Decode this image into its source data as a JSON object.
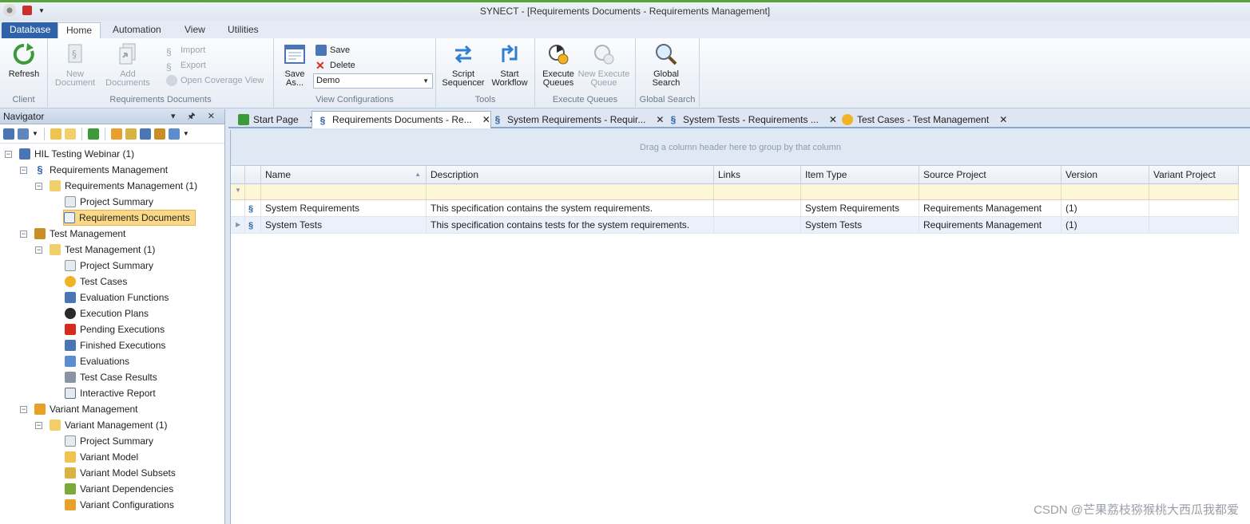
{
  "window": {
    "title": "SYNECT - [Requirements Documents - Requirements Management]"
  },
  "menu_tabs": [
    "Database",
    "Home",
    "Automation",
    "View",
    "Utilities"
  ],
  "ribbon": {
    "client": {
      "refresh": "Refresh",
      "label": "Client"
    },
    "req_docs": {
      "new_document": "New\nDocument",
      "add_documents": "Add\nDocuments",
      "import": "Import",
      "export": "Export",
      "open_coverage": "Open Coverage View",
      "label": "Requirements Documents"
    },
    "view_configs": {
      "save_as": "Save\nAs...",
      "save": "Save",
      "delete": "Delete",
      "selected": "Demo",
      "label": "View Configurations"
    },
    "tools": {
      "script_sequencer": "Script\nSequencer",
      "start_workflow": "Start\nWorkflow",
      "label": "Tools"
    },
    "execute_queues": {
      "execute": "Execute\nQueues",
      "new_execute": "New Execute\nQueue",
      "label": "Execute Queues"
    },
    "global_search": {
      "button": "Global\nSearch",
      "label": "Global Search"
    }
  },
  "navigator": {
    "title": "Navigator",
    "tree": [
      {
        "label": "HIL Testing Webinar (1)",
        "icon": "project-icon"
      },
      {
        "label": "Requirements Management",
        "icon": "requirements-icon"
      },
      {
        "label": "Requirements Management (1)",
        "icon": "requirements-folder-icon"
      },
      {
        "label": "Project Summary",
        "icon": "summary-icon"
      },
      {
        "label": "Requirements Documents",
        "icon": "document-icon"
      },
      {
        "label": "Test Management",
        "icon": "test-management-icon"
      },
      {
        "label": "Test Management  (1)",
        "icon": "test-folder-icon"
      },
      {
        "label": "Project Summary",
        "icon": "summary-icon"
      },
      {
        "label": "Test Cases",
        "icon": "test-cases-icon"
      },
      {
        "label": "Evaluation Functions",
        "icon": "evaluation-functions-icon"
      },
      {
        "label": "Execution Plans",
        "icon": "execution-plans-icon"
      },
      {
        "label": "Pending Executions",
        "icon": "pending-icon"
      },
      {
        "label": "Finished Executions",
        "icon": "finished-icon"
      },
      {
        "label": "Evaluations",
        "icon": "evaluations-icon"
      },
      {
        "label": "Test Case Results",
        "icon": "results-icon"
      },
      {
        "label": "Interactive Report",
        "icon": "report-icon"
      },
      {
        "label": "Variant Management",
        "icon": "variant-icon"
      },
      {
        "label": "Variant Management (1)",
        "icon": "variant-folder-icon"
      },
      {
        "label": "Project Summary",
        "icon": "summary-icon"
      },
      {
        "label": "Variant Model",
        "icon": "variant-model-icon"
      },
      {
        "label": "Variant Model Subsets",
        "icon": "subsets-icon"
      },
      {
        "label": "Variant Dependencies",
        "icon": "dependencies-icon"
      },
      {
        "label": "Variant Configurations",
        "icon": "configurations-icon"
      }
    ]
  },
  "doc_tabs": [
    "Start Page",
    "Requirements Documents - Re...",
    "System Requirements - Requir...",
    "System Tests - Requirements ...",
    "Test Cases - Test Management"
  ],
  "grid": {
    "group_hint": "Drag a column header here to group by that column",
    "columns": [
      "Name",
      "Description",
      "Links",
      "Item Type",
      "Source Project",
      "Version",
      "Variant Project"
    ],
    "rows": [
      [
        "System Requirements",
        "This specification contains the system requirements.",
        "",
        "System Requirements",
        "Requirements Management",
        "(1)",
        ""
      ],
      [
        "System Tests",
        "This specification contains tests for the system requirements.",
        "",
        "System Tests",
        "Requirements Management",
        "(1)",
        ""
      ]
    ]
  },
  "watermark": "CSDN @芒果荔枝猕猴桃大西瓜我都爱",
  "colors": {
    "accent": "#2f62a8",
    "selection": "#fbd986",
    "title_border": "#5aa33a"
  }
}
